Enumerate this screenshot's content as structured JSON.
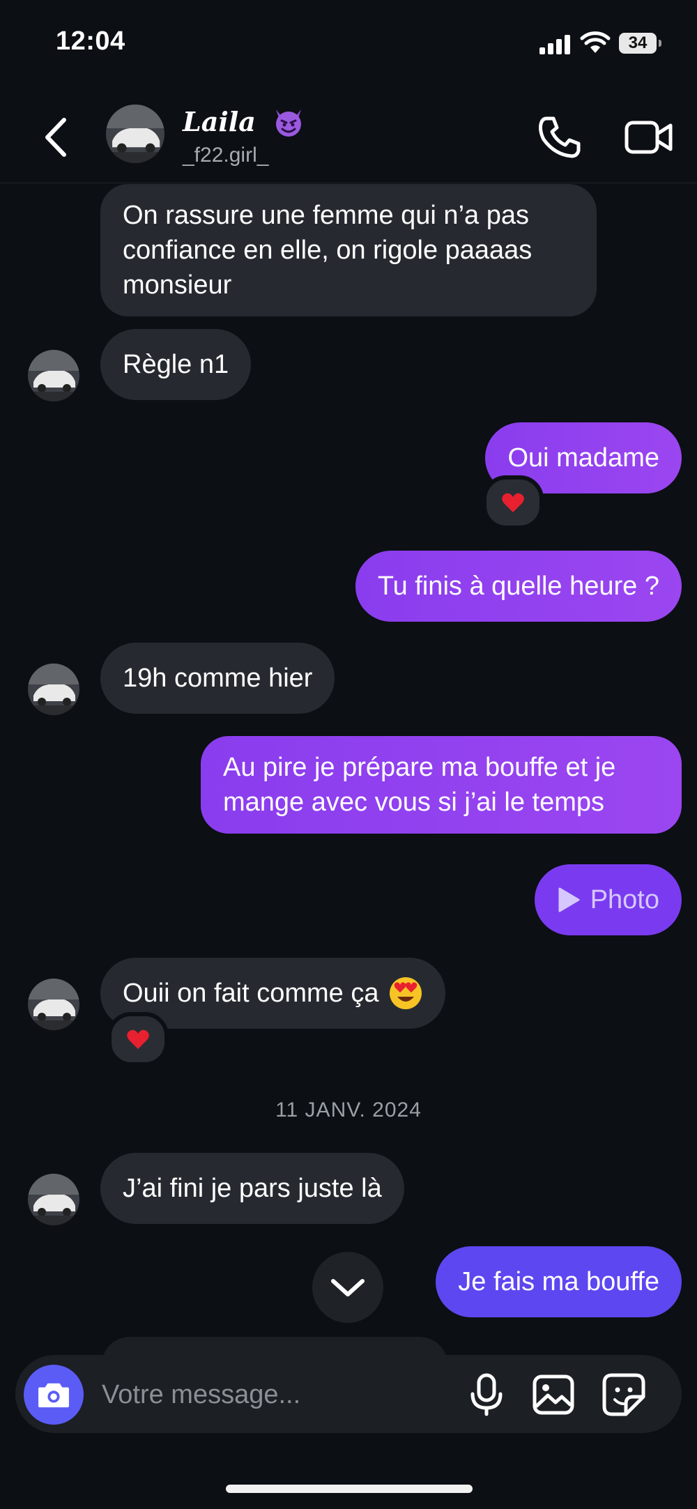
{
  "status_bar": {
    "time": "12:04",
    "battery": "34"
  },
  "header": {
    "name": "Laila",
    "name_emoji": "smiling-devil-emoji",
    "handle": "_f22.girl_"
  },
  "messages": [
    {
      "side": "in",
      "text": "On rassure une femme qui n’a pas confiance en elle, on rigole paaaas monsieur"
    },
    {
      "side": "in",
      "text": "Règle n1"
    },
    {
      "side": "out",
      "text": "Oui madame",
      "reaction": "red-heart"
    },
    {
      "side": "out",
      "text": "Tu finis à quelle heure ?"
    },
    {
      "side": "in",
      "text": "19h comme hier"
    },
    {
      "side": "out",
      "text": "Au pire je prépare ma bouffe et je mange avec vous si j’ai le temps"
    },
    {
      "side": "out",
      "text": "Photo",
      "icon": "play-icon"
    },
    {
      "side": "in",
      "text": "Ouii on fait comme ça",
      "emoji": "heart-eyes-emoji",
      "reaction": "red-heart"
    },
    {
      "side": "in",
      "text": "J’ai fini je pars juste là"
    },
    {
      "side": "out",
      "text": "Je fais ma bouffe"
    }
  ],
  "date_separator": "11 JANV. 2024",
  "composer": {
    "placeholder": "Votre message..."
  },
  "colors": {
    "background": "#0c0f14",
    "incoming_bubble": "#262a30",
    "outgoing_purple": "#9141ef",
    "outgoing_blue": "#5d47f0",
    "camera_button": "#5b5cf6"
  }
}
